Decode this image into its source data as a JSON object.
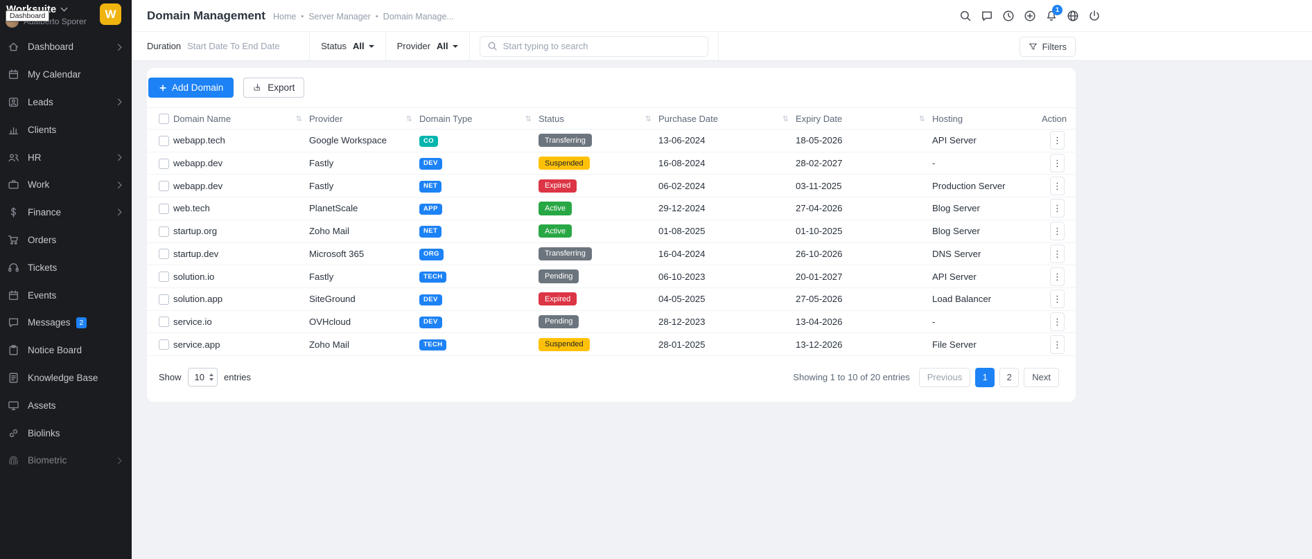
{
  "sidebar": {
    "brand": "Worksuite",
    "logo_letter": "W",
    "user_name": "Adalberto Sporer",
    "tooltip": "Dashboard",
    "items": [
      {
        "label": "Dashboard",
        "icon": "home-icon",
        "chevron": true
      },
      {
        "label": "My Calendar",
        "icon": "calendar-icon",
        "chevron": false
      },
      {
        "label": "Leads",
        "icon": "user-icon",
        "chevron": true
      },
      {
        "label": "Clients",
        "icon": "chart-icon",
        "chevron": false
      },
      {
        "label": "HR",
        "icon": "people-icon",
        "chevron": true
      },
      {
        "label": "Work",
        "icon": "briefcase-icon",
        "chevron": true
      },
      {
        "label": "Finance",
        "icon": "dollar-icon",
        "chevron": true
      },
      {
        "label": "Orders",
        "icon": "cart-icon",
        "chevron": false
      },
      {
        "label": "Tickets",
        "icon": "headset-icon",
        "chevron": false
      },
      {
        "label": "Events",
        "icon": "calendar-icon",
        "chevron": false
      },
      {
        "label": "Messages",
        "icon": "chat-icon",
        "chevron": false,
        "badge": "2"
      },
      {
        "label": "Notice Board",
        "icon": "clipboard-icon",
        "chevron": false
      },
      {
        "label": "Knowledge Base",
        "icon": "document-icon",
        "chevron": false
      },
      {
        "label": "Assets",
        "icon": "monitor-icon",
        "chevron": false
      },
      {
        "label": "Biolinks",
        "icon": "link-icon",
        "chevron": false
      },
      {
        "label": "Biometric",
        "icon": "fingerprint-icon",
        "chevron": true,
        "faded": true
      }
    ]
  },
  "header": {
    "title": "Domain Management",
    "breadcrumb": [
      "Home",
      "Server Manager",
      "Domain Manage..."
    ],
    "icons": [
      "search-icon",
      "message-icon",
      "clock-icon",
      "plus-circle-icon",
      "bell-icon",
      "globe-icon",
      "power-icon"
    ],
    "notification_count": "1"
  },
  "filters": {
    "duration_label": "Duration",
    "duration_placeholder": "Start Date To End Date",
    "status_label": "Status",
    "status_value": "All",
    "provider_label": "Provider",
    "provider_value": "All",
    "search_placeholder": "Start typing to search",
    "filters_label": "Filters"
  },
  "toolbar": {
    "add_domain_label": "Add Domain",
    "export_label": "Export"
  },
  "table": {
    "columns": [
      {
        "label": "Domain Name",
        "sortable": true
      },
      {
        "label": "Provider",
        "sortable": true
      },
      {
        "label": "Domain Type",
        "sortable": true
      },
      {
        "label": "Status",
        "sortable": true
      },
      {
        "label": "Purchase Date",
        "sortable": true
      },
      {
        "label": "Expiry Date",
        "sortable": true
      },
      {
        "label": "Hosting",
        "sortable": false
      },
      {
        "label": "Action",
        "sortable": false
      }
    ],
    "rows": [
      {
        "domain": "webapp.tech",
        "provider": "Google Workspace",
        "type": "CO",
        "status": "Transferring",
        "purchase_date": "13-06-2024",
        "expiry_date": "18-05-2026",
        "hosting": "API Server"
      },
      {
        "domain": "webapp.dev",
        "provider": "Fastly",
        "type": "DEV",
        "status": "Suspended",
        "purchase_date": "16-08-2024",
        "expiry_date": "28-02-2027",
        "hosting": "-"
      },
      {
        "domain": "webapp.dev",
        "provider": "Fastly",
        "type": "NET",
        "status": "Expired",
        "purchase_date": "06-02-2024",
        "expiry_date": "03-11-2025",
        "hosting": "Production Server"
      },
      {
        "domain": "web.tech",
        "provider": "PlanetScale",
        "type": "APP",
        "status": "Active",
        "purchase_date": "29-12-2024",
        "expiry_date": "27-04-2026",
        "hosting": "Blog Server"
      },
      {
        "domain": "startup.org",
        "provider": "Zoho Mail",
        "type": "NET",
        "status": "Active",
        "purchase_date": "01-08-2025",
        "expiry_date": "01-10-2025",
        "hosting": "Blog Server"
      },
      {
        "domain": "startup.dev",
        "provider": "Microsoft 365",
        "type": "ORG",
        "status": "Transferring",
        "purchase_date": "16-04-2024",
        "expiry_date": "26-10-2026",
        "hosting": "DNS Server"
      },
      {
        "domain": "solution.io",
        "provider": "Fastly",
        "type": "TECH",
        "status": "Pending",
        "purchase_date": "06-10-2023",
        "expiry_date": "20-01-2027",
        "hosting": "API Server"
      },
      {
        "domain": "solution.app",
        "provider": "SiteGround",
        "type": "DEV",
        "status": "Expired",
        "purchase_date": "04-05-2025",
        "expiry_date": "27-05-2026",
        "hosting": "Load Balancer"
      },
      {
        "domain": "service.io",
        "provider": "OVHcloud",
        "type": "DEV",
        "status": "Pending",
        "purchase_date": "28-12-2023",
        "expiry_date": "13-04-2026",
        "hosting": "-"
      },
      {
        "domain": "service.app",
        "provider": "Zoho Mail",
        "type": "TECH",
        "status": "Suspended",
        "purchase_date": "28-01-2025",
        "expiry_date": "13-12-2026",
        "hosting": "File Server"
      }
    ]
  },
  "colors": {
    "accent": "#1d82f5",
    "sidebar_bg": "#1b1c20",
    "logo_yellow": "#f0b40f",
    "type_badges": {
      "CO": "#00b5ad",
      "default": "#1d82f5"
    },
    "status_badges": {
      "Transferring": {
        "bg": "#6c757d",
        "fg": "#ffffff"
      },
      "Suspended": {
        "bg": "#ffc107",
        "fg": "#212529"
      },
      "Expired": {
        "bg": "#dc3545",
        "fg": "#ffffff"
      },
      "Active": {
        "bg": "#28a745",
        "fg": "#ffffff"
      },
      "Pending": {
        "bg": "#6c757d",
        "fg": "#ffffff"
      }
    }
  },
  "footer": {
    "show_label": "Show",
    "per_page": "10",
    "entries_label": "entries",
    "showing_text": "Showing 1 to 10 of 20 entries",
    "pagination": {
      "previous": "Previous",
      "pages": [
        "1",
        "2"
      ],
      "active": "1",
      "next": "Next"
    }
  }
}
